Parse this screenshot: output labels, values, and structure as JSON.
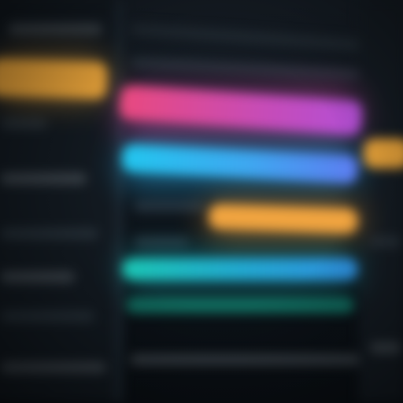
{
  "window": {
    "title": ""
  },
  "timeline": {
    "bars": [
      {
        "color": "#e8a33a"
      },
      {
        "color_start": "#e9497e",
        "color_end": "#b24fd6"
      },
      {
        "color": "#e8a33a"
      },
      {
        "color_start": "#22c6ee",
        "color_end": "#5d7cf0"
      },
      {
        "color": "#f0a440"
      },
      {
        "color_start": "#1bc7b4",
        "color_end": "#2f8fe0"
      },
      {
        "color": "#127a6a"
      }
    ]
  },
  "colors": {
    "background": "#0d131a",
    "sidebar": "#121920",
    "text_placeholder": "#5b646c"
  }
}
